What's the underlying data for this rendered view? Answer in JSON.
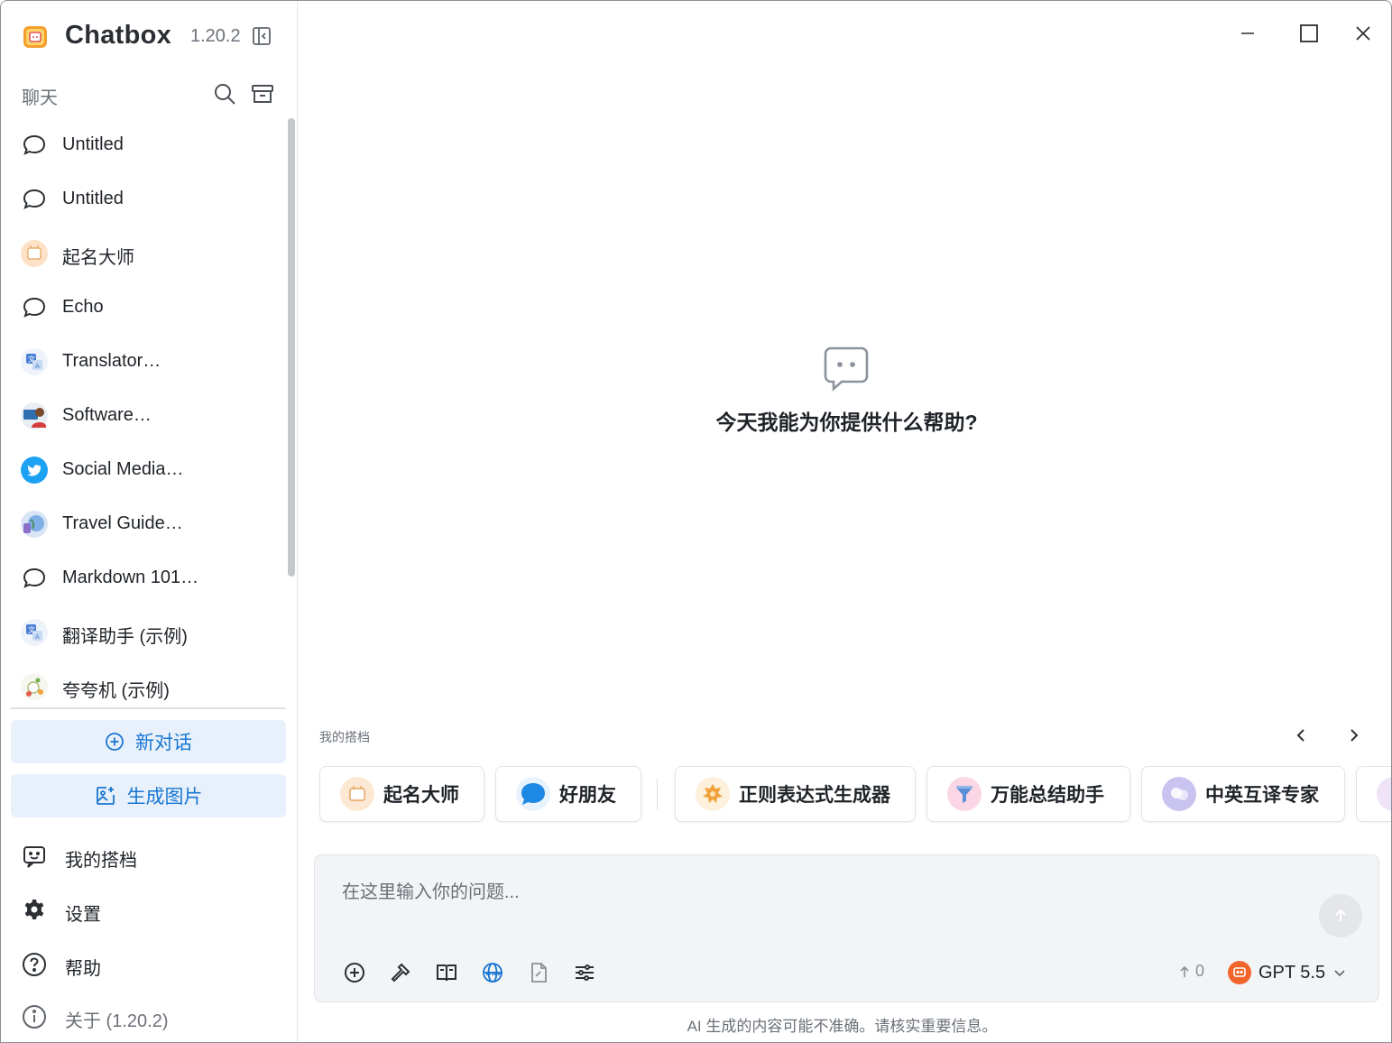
{
  "app": {
    "name": "Chatbox",
    "version": "1.20.2"
  },
  "sidebar": {
    "section_title": "聊天",
    "chats": [
      {
        "label": "Untitled",
        "icon": "chat-bubble-icon"
      },
      {
        "label": "Untitled",
        "icon": "chat-bubble-icon"
      },
      {
        "label": "起名大师",
        "icon": "naming-master-avatar"
      },
      {
        "label": "Echo",
        "icon": "chat-bubble-icon"
      },
      {
        "label": "Translator…",
        "icon": "translator-avatar"
      },
      {
        "label": "Software…",
        "icon": "software-avatar"
      },
      {
        "label": "Social Media…",
        "icon": "twitter-avatar"
      },
      {
        "label": "Travel Guide…",
        "icon": "travel-avatar"
      },
      {
        "label": "Markdown 101…",
        "icon": "chat-bubble-icon"
      },
      {
        "label": "翻译助手 (示例)",
        "icon": "translator-avatar"
      },
      {
        "label": "夸夸机 (示例)",
        "icon": "praise-avatar"
      }
    ],
    "new_chat_label": "新对话",
    "generate_image_label": "生成图片",
    "menu": [
      {
        "label": "我的搭档",
        "icon": "partner-icon"
      },
      {
        "label": "设置",
        "icon": "gear-icon"
      },
      {
        "label": "帮助",
        "icon": "help-icon"
      },
      {
        "label": "关于 (1.20.2)",
        "icon": "info-icon"
      }
    ]
  },
  "main": {
    "welcome_title": "今天我能为你提供什么帮助?",
    "partners_label": "我的搭档",
    "partners": [
      {
        "name": "起名大师",
        "color": "#fde8d4"
      },
      {
        "name": "好朋友",
        "color": "#e8f3fd"
      },
      {
        "name": "正则表达式生成器",
        "color": "#fdf0dc"
      },
      {
        "name": "万能总结助手",
        "color": "#fbd7e6"
      },
      {
        "name": "中英互译专家",
        "color": "#c9c3f0"
      }
    ],
    "composer": {
      "placeholder": "在这里输入你的问题...",
      "token_count": "0",
      "model_name": "GPT 5.5"
    },
    "disclaimer": "AI 生成的内容可能不准确。请核实重要信息。"
  },
  "colors": {
    "accent": "#1976d2",
    "accent_bg": "#e8f1fb",
    "model_logo": "#f2652a"
  }
}
